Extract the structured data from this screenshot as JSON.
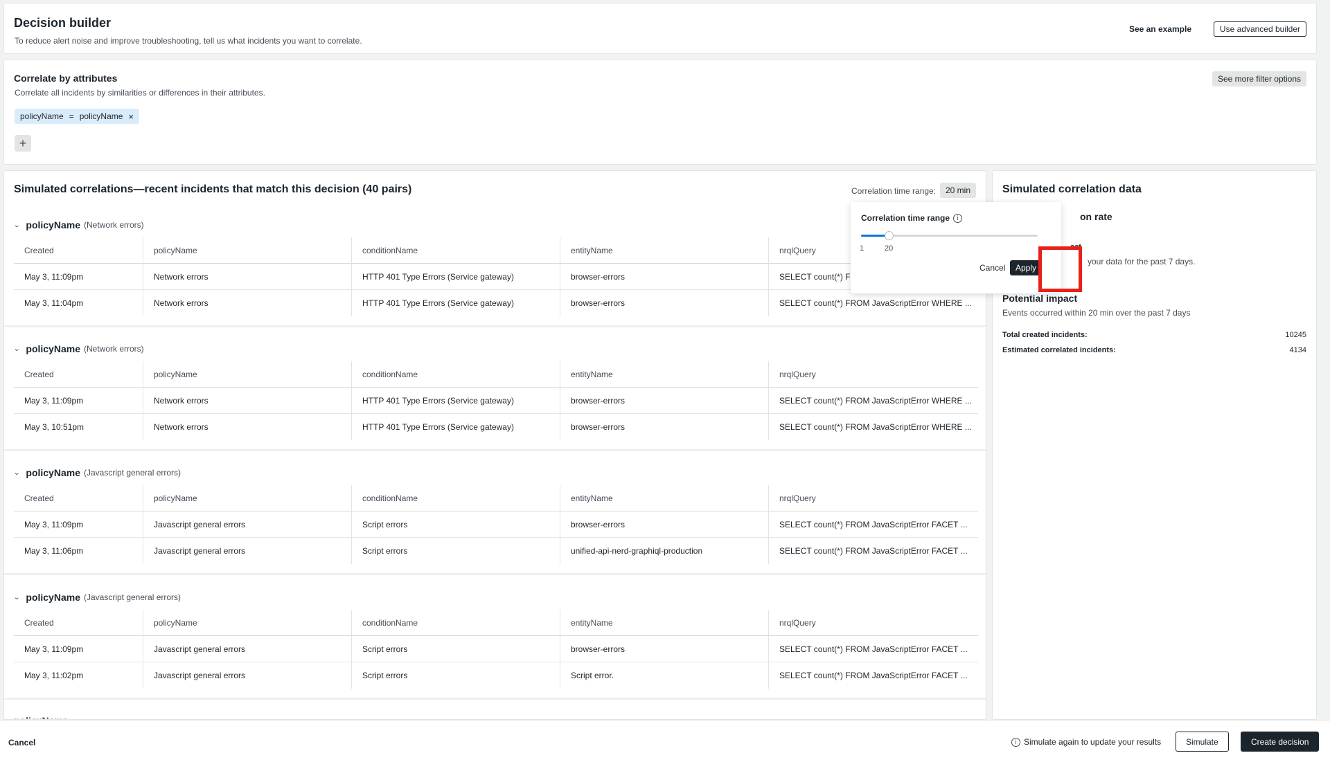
{
  "header": {
    "title": "Decision builder",
    "description": "To reduce alert noise and improve troubleshooting, tell us what incidents you want to correlate.",
    "see_example": "See an example",
    "advanced_builder": "Use advanced builder"
  },
  "attributes": {
    "title": "Correlate by attributes",
    "description": "Correlate all incidents by similarities or differences in their attributes.",
    "chip": {
      "left": "policyName",
      "operator": "=",
      "right": "policyName",
      "remove": "×"
    },
    "add": "+",
    "more_filters": "See more filter options"
  },
  "simulated": {
    "title": "Simulated correlations—recent incidents that match this decision (40 pairs)",
    "range_label": "Correlation time range:",
    "range_value": "20 min",
    "columns": [
      "Created",
      "policyName",
      "conditionName",
      "entityName",
      "nrqlQuery"
    ],
    "groups": [
      {
        "key": "policyName",
        "sub": "(Network errors)",
        "rows": [
          [
            "May 3, 11:09pm",
            "Network errors",
            "HTTP 401 Type Errors (Service gateway)",
            "browser-errors",
            "SELECT count(*) FR"
          ],
          [
            "May 3, 11:04pm",
            "Network errors",
            "HTTP 401 Type Errors (Service gateway)",
            "browser-errors",
            "SELECT count(*) FROM JavaScriptError WHERE ..."
          ]
        ]
      },
      {
        "key": "policyName",
        "sub": "(Network errors)",
        "rows": [
          [
            "May 3, 11:09pm",
            "Network errors",
            "HTTP 401 Type Errors (Service gateway)",
            "browser-errors",
            "SELECT count(*) FROM JavaScriptError WHERE ..."
          ],
          [
            "May 3, 10:51pm",
            "Network errors",
            "HTTP 401 Type Errors (Service gateway)",
            "browser-errors",
            "SELECT count(*) FROM JavaScriptError WHERE ..."
          ]
        ]
      },
      {
        "key": "policyName",
        "sub": "(Javascript general errors)",
        "rows": [
          [
            "May 3, 11:09pm",
            "Javascript general errors",
            "Script errors",
            "browser-errors",
            "SELECT count(*) FROM JavaScriptError FACET ..."
          ],
          [
            "May 3, 11:06pm",
            "Javascript general errors",
            "Script errors",
            "unified-api-nerd-graphiql-production",
            "SELECT count(*) FROM JavaScriptError FACET ..."
          ]
        ]
      },
      {
        "key": "policyName",
        "sub": "(Javascript general errors)",
        "rows": [
          [
            "May 3, 11:09pm",
            "Javascript general errors",
            "Script errors",
            "browser-errors",
            "SELECT count(*) FROM JavaScriptError FACET ..."
          ],
          [
            "May 3, 11:02pm",
            "Javascript general errors",
            "Script errors",
            "Script error.",
            "SELECT count(*) FROM JavaScriptError FACET ..."
          ]
        ]
      }
    ],
    "peek_label": "policyName"
  },
  "popover": {
    "title": "Correlation time range",
    "info_icon": "info-icon",
    "slider": {
      "min": 1,
      "max": 120,
      "value": 20,
      "min_label": "1",
      "value_label": "20"
    },
    "cancel": "Cancel",
    "apply": "Apply"
  },
  "data_panel": {
    "title": "Simulated correlation data",
    "rate_title": "on rate",
    "impact_sub": "act",
    "impact_note": "your data for the past 7 days.",
    "potential_title": "Potential impact",
    "potential_desc": "Events occurred within 20 min over the past 7 days",
    "total_label": "Total created incidents:",
    "total_value": "10245",
    "estimated_label": "Estimated correlated incidents:",
    "estimated_value": "4134"
  },
  "footer": {
    "cancel": "Cancel",
    "note": "Simulate again to update your results",
    "simulate": "Simulate",
    "create": "Create decision"
  },
  "colors": {
    "accent": "#0c74df",
    "highlight": "#e8201a",
    "primary_button": "#1d252c"
  }
}
